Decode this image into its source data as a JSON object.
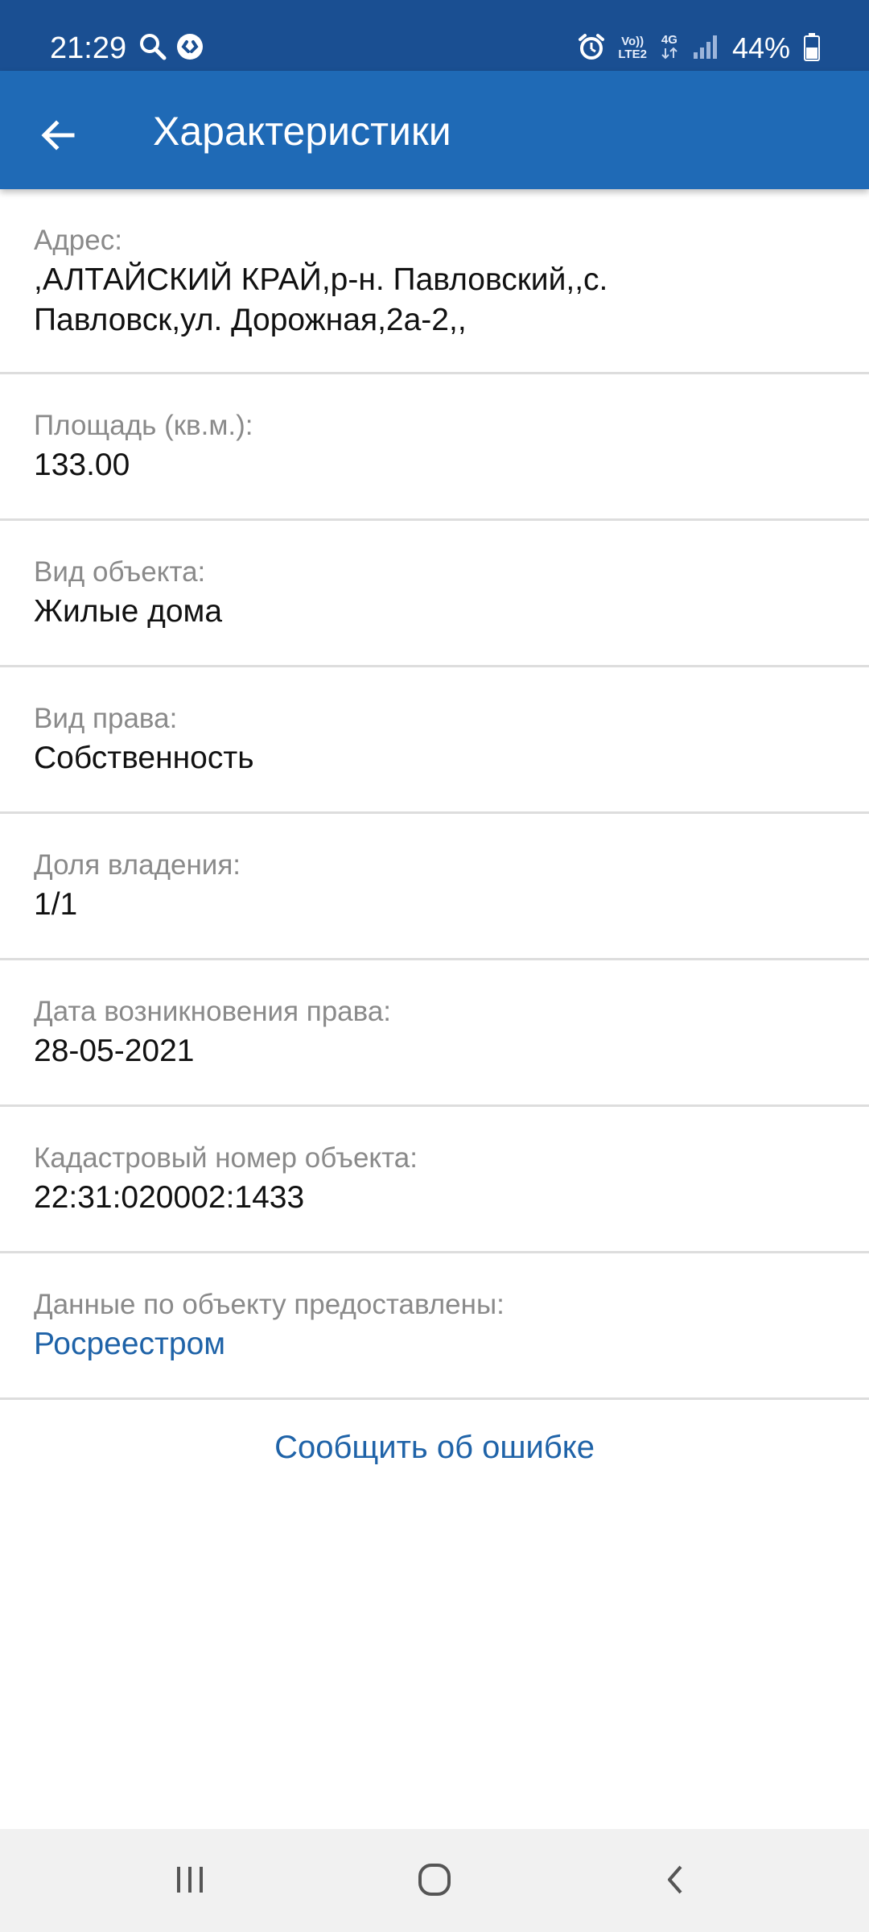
{
  "status_bar": {
    "time": "21:29",
    "left_icons": [
      "search-icon",
      "shazam-icon"
    ],
    "right_icons": [
      "alarm-icon",
      "volte-icon",
      "4g-icon",
      "signal-icon",
      "battery-icon"
    ],
    "volte_line1": "Vo))",
    "volte_line2": "LTE2",
    "net_type": "4G",
    "battery": "44%"
  },
  "app_bar": {
    "back_icon": "arrow-left-icon",
    "title": "Характеристики",
    "background": "#1f6ab6"
  },
  "fields": [
    {
      "label": "Адрес:",
      "value_line1": ",АЛТАЙСКИЙ КРАЙ,р-н. Павловский,,с.",
      "value_line2": "Павловск,ул. Дорожная,2а-2,,"
    },
    {
      "label": "Площадь (кв.м.):",
      "value": "133.00"
    },
    {
      "label": "Вид объекта:",
      "value": "Жилые дома"
    },
    {
      "label": "Вид права:",
      "value": "Собственность"
    },
    {
      "label": "Доля владения:",
      "value": "1/1"
    },
    {
      "label": "Дата возникновения права:",
      "value": "28-05-2021"
    },
    {
      "label": "Кадастровый номер объекта:",
      "value": "22:31:020002:1433"
    },
    {
      "label": "Данные по объекту предоставлены:",
      "value": "Росреестром"
    }
  ],
  "report_error": "Сообщить об ошибке",
  "link_color": "#1f63a8",
  "nav_bar": {
    "icons": [
      "recent-apps-icon",
      "home-icon",
      "back-icon"
    ]
  }
}
